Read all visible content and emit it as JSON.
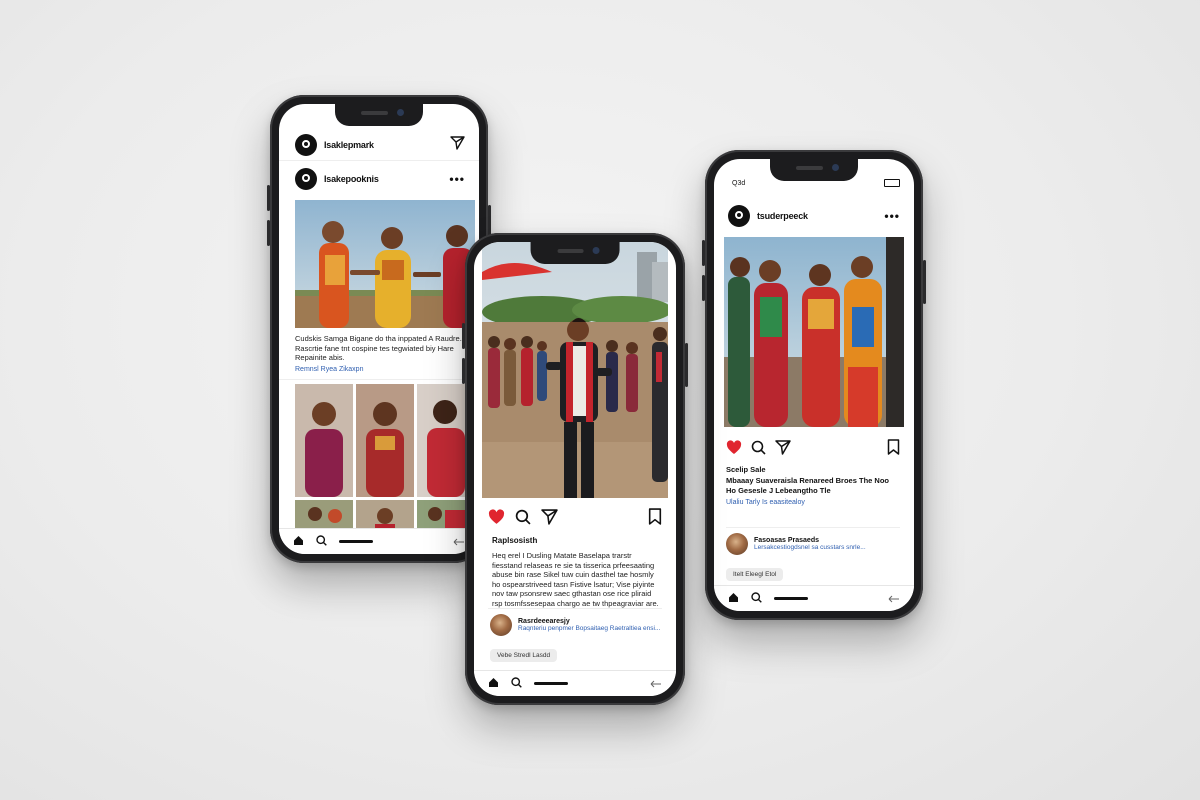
{
  "phone_left": {
    "header_username": "Isaklepmark",
    "post_username": "Isakepooknis",
    "caption": "Cudskis Samga Bigane do tha inppated A Raudre. Rascrtie fane tnt cospine tes tegwiated biy Hare Repainite abis.",
    "link": "Remnsl Ryea Zikaxpn"
  },
  "phone_center": {
    "username": "Raplsosisth",
    "caption": "Heq erel I Dusling Matate Baselapa trarstr fiesstand relaseas re sie ta tisserica prfeesaating abuse bin rase Sikel tuw cuin dasthel tae hosmly ho ospearstriveed tasn Fistive lsatur; Vise piyinte nov taw psonsrew saec gthastan ose rice pliraid rsp tosmfssesepaa chargo ae tw thpeagraviar are.",
    "comment_user": "Rasrdeeearesjy",
    "comment_text": "Raqnteriu penpmer Bopsaitaeg Raetraltiea ensi...",
    "chip": "Vebe Stredl Lasdd"
  },
  "phone_right": {
    "status_time": "Q3d",
    "username": "tsuderpeeck",
    "likes": "Scelip Sale",
    "caption_title": "Mbaaay Suaveraisla Renareed Broes The Noo Ho Gesesle J Lebeangtho Tle",
    "link": "Ulaliu Tarly Is eaasitealoy",
    "comment_user": "Fasoasas Prasaeds",
    "comment_text": "Lersakcestiogdsnel sa cusstars snrle...",
    "chip": "Itelt Eleegl Etol"
  },
  "colors": {
    "like_red": "#e0252f",
    "link_blue": "#2f5fb0",
    "phone_frame": "#1c1c1e"
  },
  "icons": [
    "home-icon",
    "search-icon",
    "send-icon",
    "heart-icon",
    "bookmark-icon",
    "more-icon",
    "back-icon"
  ]
}
